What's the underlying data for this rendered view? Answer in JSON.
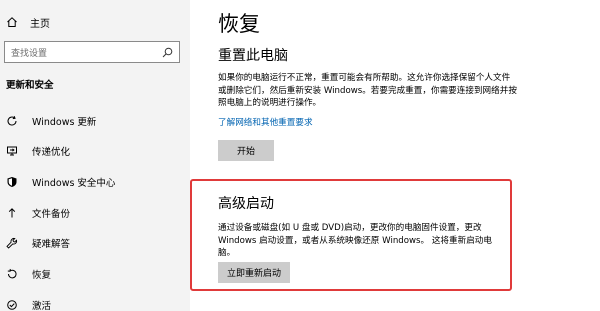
{
  "sidebar": {
    "home_label": "主页",
    "search_placeholder": "查找设置",
    "section_title": "更新和安全",
    "items": [
      {
        "label": "Windows 更新",
        "icon": "refresh-icon"
      },
      {
        "label": "传递优化",
        "icon": "delivery-optimization-icon"
      },
      {
        "label": "Windows 安全中心",
        "icon": "shield-icon"
      },
      {
        "label": "文件备份",
        "icon": "backup-icon"
      },
      {
        "label": "疑难解答",
        "icon": "wrench-icon"
      },
      {
        "label": "恢复",
        "icon": "recovery-icon"
      },
      {
        "label": "激活",
        "icon": "activation-icon"
      }
    ]
  },
  "main": {
    "title": "恢复",
    "reset": {
      "heading": "重置此电脑",
      "description": "如果你的电脑运行不正常，重置可能会有所帮助。这允许你选择保留个人文件或删除它们，然后重新安装 Windows。若要完成重置，你需要连接到网络并按照电脑上的说明进行操作。",
      "link": "了解网络和其他重置要求",
      "button": "开始"
    },
    "advanced": {
      "heading": "高级启动",
      "description": "通过设备或磁盘(如 U 盘或 DVD)启动，更改你的电脑固件设置，更改 Windows 启动设置，或者从系统映像还原 Windows。 这将重新启动电脑。",
      "button": "立即重新启动"
    }
  },
  "colors": {
    "sidebar_bg": "#f3f3f3",
    "link": "#0063b1",
    "button_bg": "#cccccc",
    "highlight": "#e03a3a"
  }
}
